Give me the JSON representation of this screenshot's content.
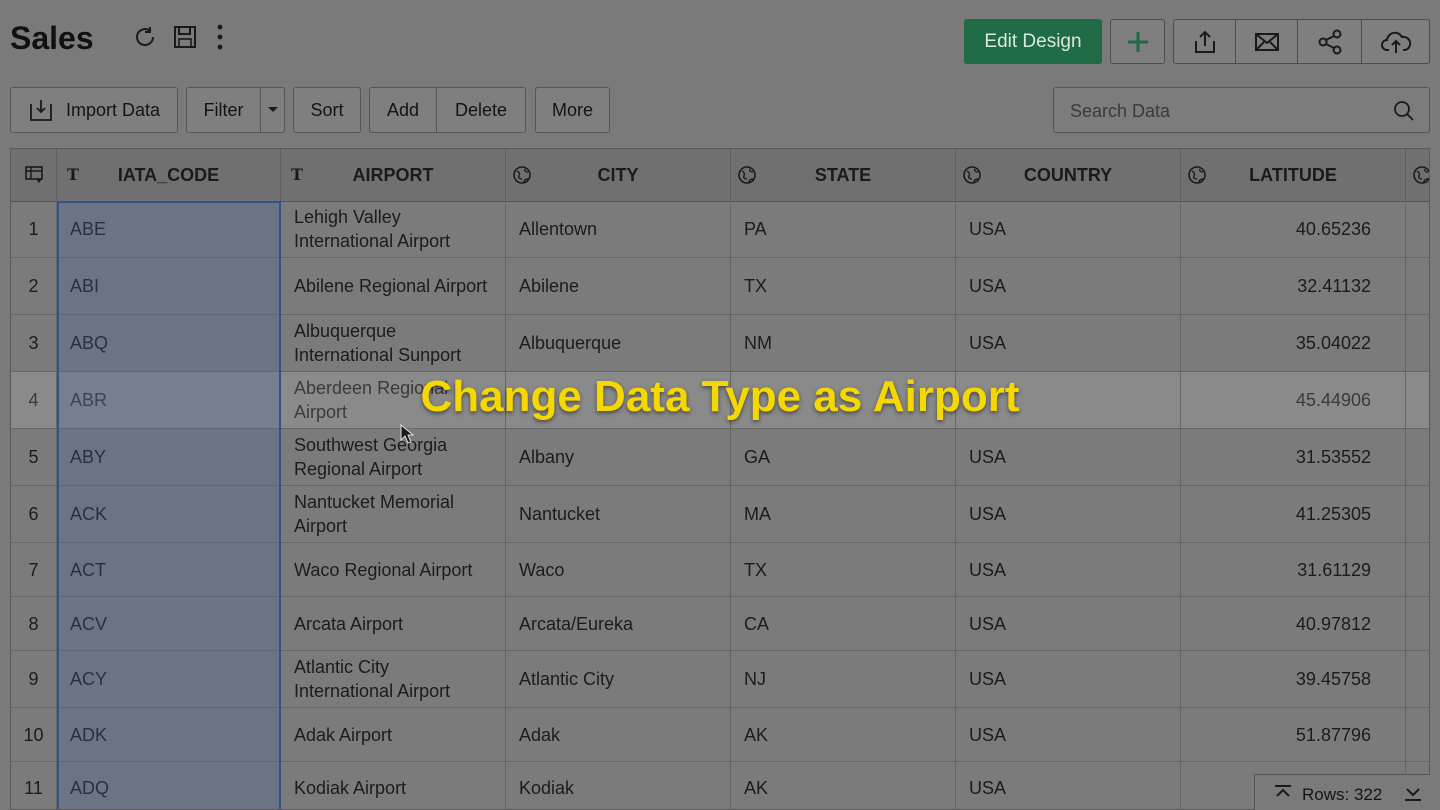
{
  "app": {
    "title": "Sales"
  },
  "toolbar": {
    "edit_design_label": "Edit Design",
    "import_label": "Import Data",
    "filter_label": "Filter",
    "sort_label": "Sort",
    "add_label": "Add",
    "delete_label": "Delete",
    "more_label": "More",
    "search_placeholder": "Search Data"
  },
  "grid": {
    "columns": [
      {
        "name": "IATA_CODE",
        "type_icon": "T"
      },
      {
        "name": "AIRPORT",
        "type_icon": "T"
      },
      {
        "name": "CITY",
        "type_icon": "globe-icon"
      },
      {
        "name": "STATE",
        "type_icon": "globe-icon"
      },
      {
        "name": "COUNTRY",
        "type_icon": "globe-icon"
      },
      {
        "name": "LATITUDE",
        "type_icon": "globe-icon"
      }
    ],
    "rows": [
      {
        "num": "1",
        "code": "ABE",
        "airport": "Lehigh Valley International Airport",
        "city": "Allentown",
        "state": "PA",
        "country": "USA",
        "lat": "40.65236"
      },
      {
        "num": "2",
        "code": "ABI",
        "airport": "Abilene Regional Airport",
        "city": "Abilene",
        "state": "TX",
        "country": "USA",
        "lat": "32.41132"
      },
      {
        "num": "3",
        "code": "ABQ",
        "airport": "Albuquerque International Sunport",
        "city": "Albuquerque",
        "state": "NM",
        "country": "USA",
        "lat": "35.04022"
      },
      {
        "num": "4",
        "code": "ABR",
        "airport": "Aberdeen Regional Airport",
        "city": "",
        "state": "",
        "country": "",
        "lat": "45.44906"
      },
      {
        "num": "5",
        "code": "ABY",
        "airport": "Southwest Georgia Regional Airport",
        "city": "Albany",
        "state": "GA",
        "country": "USA",
        "lat": "31.53552"
      },
      {
        "num": "6",
        "code": "ACK",
        "airport": "Nantucket Memorial Airport",
        "city": "Nantucket",
        "state": "MA",
        "country": "USA",
        "lat": "41.25305"
      },
      {
        "num": "7",
        "code": "ACT",
        "airport": "Waco Regional Airport",
        "city": "Waco",
        "state": "TX",
        "country": "USA",
        "lat": "31.61129"
      },
      {
        "num": "8",
        "code": "ACV",
        "airport": "Arcata Airport",
        "city": "Arcata/Eureka",
        "state": "CA",
        "country": "USA",
        "lat": "40.97812"
      },
      {
        "num": "9",
        "code": "ACY",
        "airport": "Atlantic City International Airport",
        "city": "Atlantic City",
        "state": "NJ",
        "country": "USA",
        "lat": "39.45758"
      },
      {
        "num": "10",
        "code": "ADK",
        "airport": "Adak Airport",
        "city": "Adak",
        "state": "AK",
        "country": "USA",
        "lat": "51.87796"
      },
      {
        "num": "11",
        "code": "ADQ",
        "airport": "Kodiak Airport",
        "city": "Kodiak",
        "state": "AK",
        "country": "USA",
        "lat": ""
      }
    ],
    "rows_count_label": "Rows: 322"
  },
  "overlay": {
    "caption": "Change Data Type as Airport"
  },
  "colors": {
    "accent": "#1f6b46",
    "caption": "#f5d800"
  }
}
